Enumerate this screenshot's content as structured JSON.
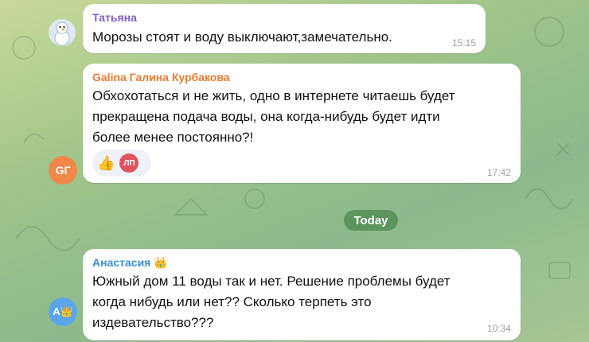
{
  "messages": [
    {
      "author": "Татьяна",
      "author_color": "#7e5fd3",
      "lines": [
        "Морозы стоят и воду выключают,замечательно."
      ],
      "time": "15:15"
    },
    {
      "author": "Galina Галина Курбакова",
      "author_color": "#ef7a2f",
      "avatar_initials": "GГ",
      "avatar_color": "#f0884a",
      "lines": [
        "Обхохотаться и не жить, одно в интернете читаешь будет",
        "прекращена подача воды, она когда-нибудь будет идти",
        "более менее постоянно?!"
      ],
      "reaction_emoji": "👍",
      "reaction_avatar_initials": "ЛП",
      "time": "17:42"
    },
    {
      "author": "Анастасия 👑",
      "author_color": "#3a8fd6",
      "avatar_initials": "А👑",
      "avatar_color": "#5aa6e8",
      "lines": [
        "Южный дом 11 воды так и нет. Решение проблемы будет",
        "когда нибудь или нет?? Сколько терпеть это",
        "издевательство???"
      ],
      "time": "10:34"
    }
  ],
  "date_separator": "Today"
}
